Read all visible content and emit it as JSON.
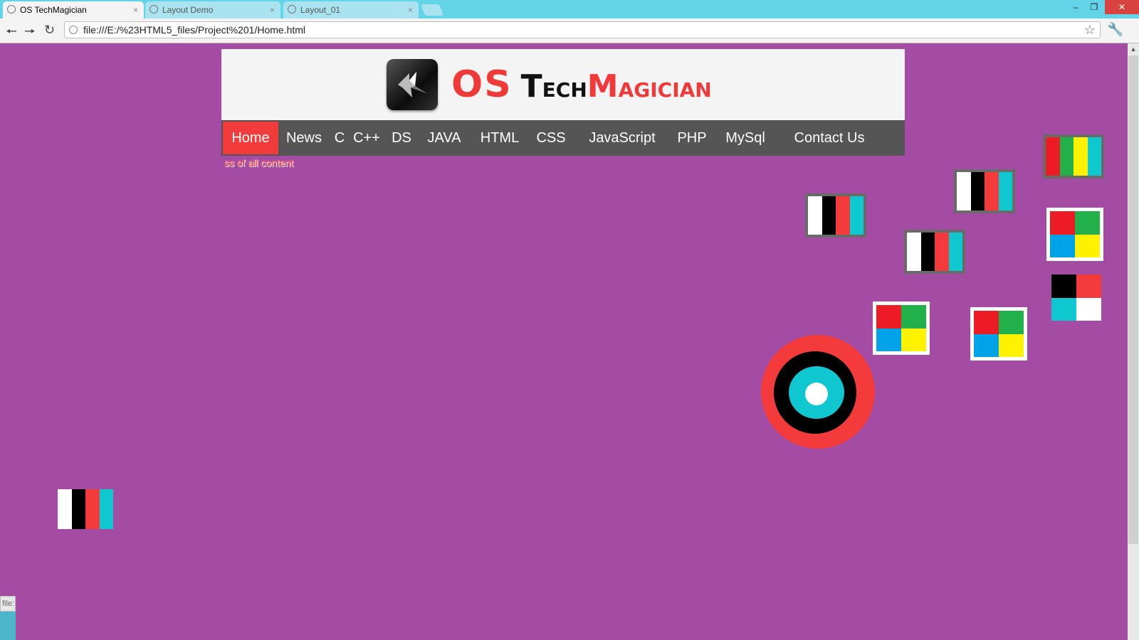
{
  "browser": {
    "tabs": [
      {
        "title": "OS TechMagician",
        "active": true
      },
      {
        "title": "Layout Demo",
        "active": false
      },
      {
        "title": "Layout_01",
        "active": false
      }
    ],
    "close_glyph": "×",
    "url": "file:///E:/%23HTML5_files/Project%201/Home.html",
    "status_text": "file:"
  },
  "header": {
    "brand_os": "OS",
    "brand_tech_initial": "T",
    "brand_tech_rest": "ECH",
    "brand_magic_initial": "M",
    "brand_magic_rest": "AGICIAN"
  },
  "nav": {
    "items": [
      "Home",
      "News",
      "C",
      "C++",
      "DS",
      "JAVA",
      "HTML",
      "CSS",
      "JavaScript",
      "PHP",
      "MySql",
      "Contact Us"
    ],
    "active": "Home"
  },
  "marquee_text": "ss of all content",
  "colors": {
    "page_bg": "#a44ba3",
    "accent_red": "#f33b3b",
    "nav_bg": "#555555",
    "cyan": "#0fc8cf",
    "green": "#22b04b",
    "yellow": "#fff200",
    "blue": "#00a2e8"
  }
}
